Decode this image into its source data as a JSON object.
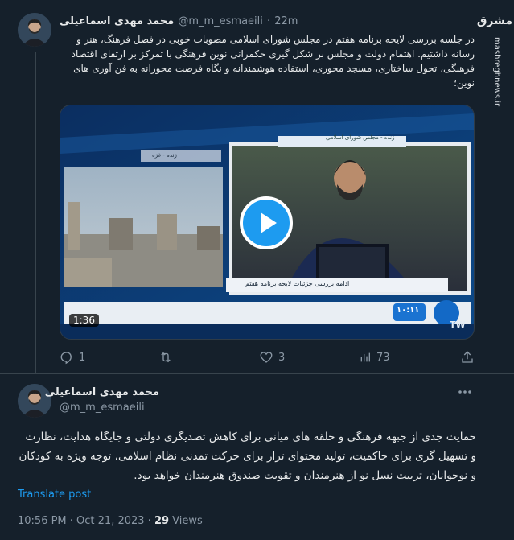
{
  "tweet1": {
    "display_name": "محمد مهدی اسماعیلی",
    "handle": "@m_m_esmaeili",
    "separator": "·",
    "time": "22m",
    "body": "در جلسه بررسی لایحه برنامه هفتم در مجلس شورای اسلامی مصوبات خوبی در فصل فرهنگ، هنر و رسانه داشتیم. اهتمام دولت و مجلس بر شکل گیری حکمرانی نوین فرهنگی با تمرکز بر ارتقای اقتصاد فرهنگی، تحول ساختاری، مسجد محوری، استفاده هوشمندانه و نگاه فرصت محورانه به فن آوری های نوین؛",
    "video": {
      "duration": "1:36",
      "tv_top_caption": "زنده - مجلس شورای اسلامی",
      "tv_left_caption": "زنده - غزه",
      "tv_bottom_caption": "ادامه بررسی جزئیات لایحه برنامه هفتم",
      "tv_time": "۱۰:۱۱",
      "tv_logo": "TW"
    },
    "actions": {
      "replies": "1",
      "reposts": "",
      "likes": "3",
      "views": "73"
    }
  },
  "tweet2": {
    "display_name": "محمد مهدی اسماعیلی",
    "handle": "@m_m_esmaeili",
    "body": "حمایت جدی از جبهه فرهنگی و حلقه های میانی برای کاهش تصدیگری دولتی و جایگاه هدایت، نظارت و تسهیل گری برای حاکمیت، تولید محتوای تراز برای حرکت تمدنی نظام اسلامی، توجه ویژه به کودکان و نوجوانان، تربیت نسل نو از هنرمندان و تقویت صندوق هنرمندان خواهد بود.",
    "translate_label": "Translate post",
    "timestamp": "10:56 PM · Oct 21, 2023 · ",
    "views_count": "29",
    "views_label": " Views"
  },
  "watermark": {
    "logo_text": "مشرق",
    "site": "mashreghnews.ir"
  },
  "colors": {
    "background": "#15202b",
    "accent": "#1d9bf0",
    "muted": "#8b98a5",
    "divider": "#38444d"
  }
}
